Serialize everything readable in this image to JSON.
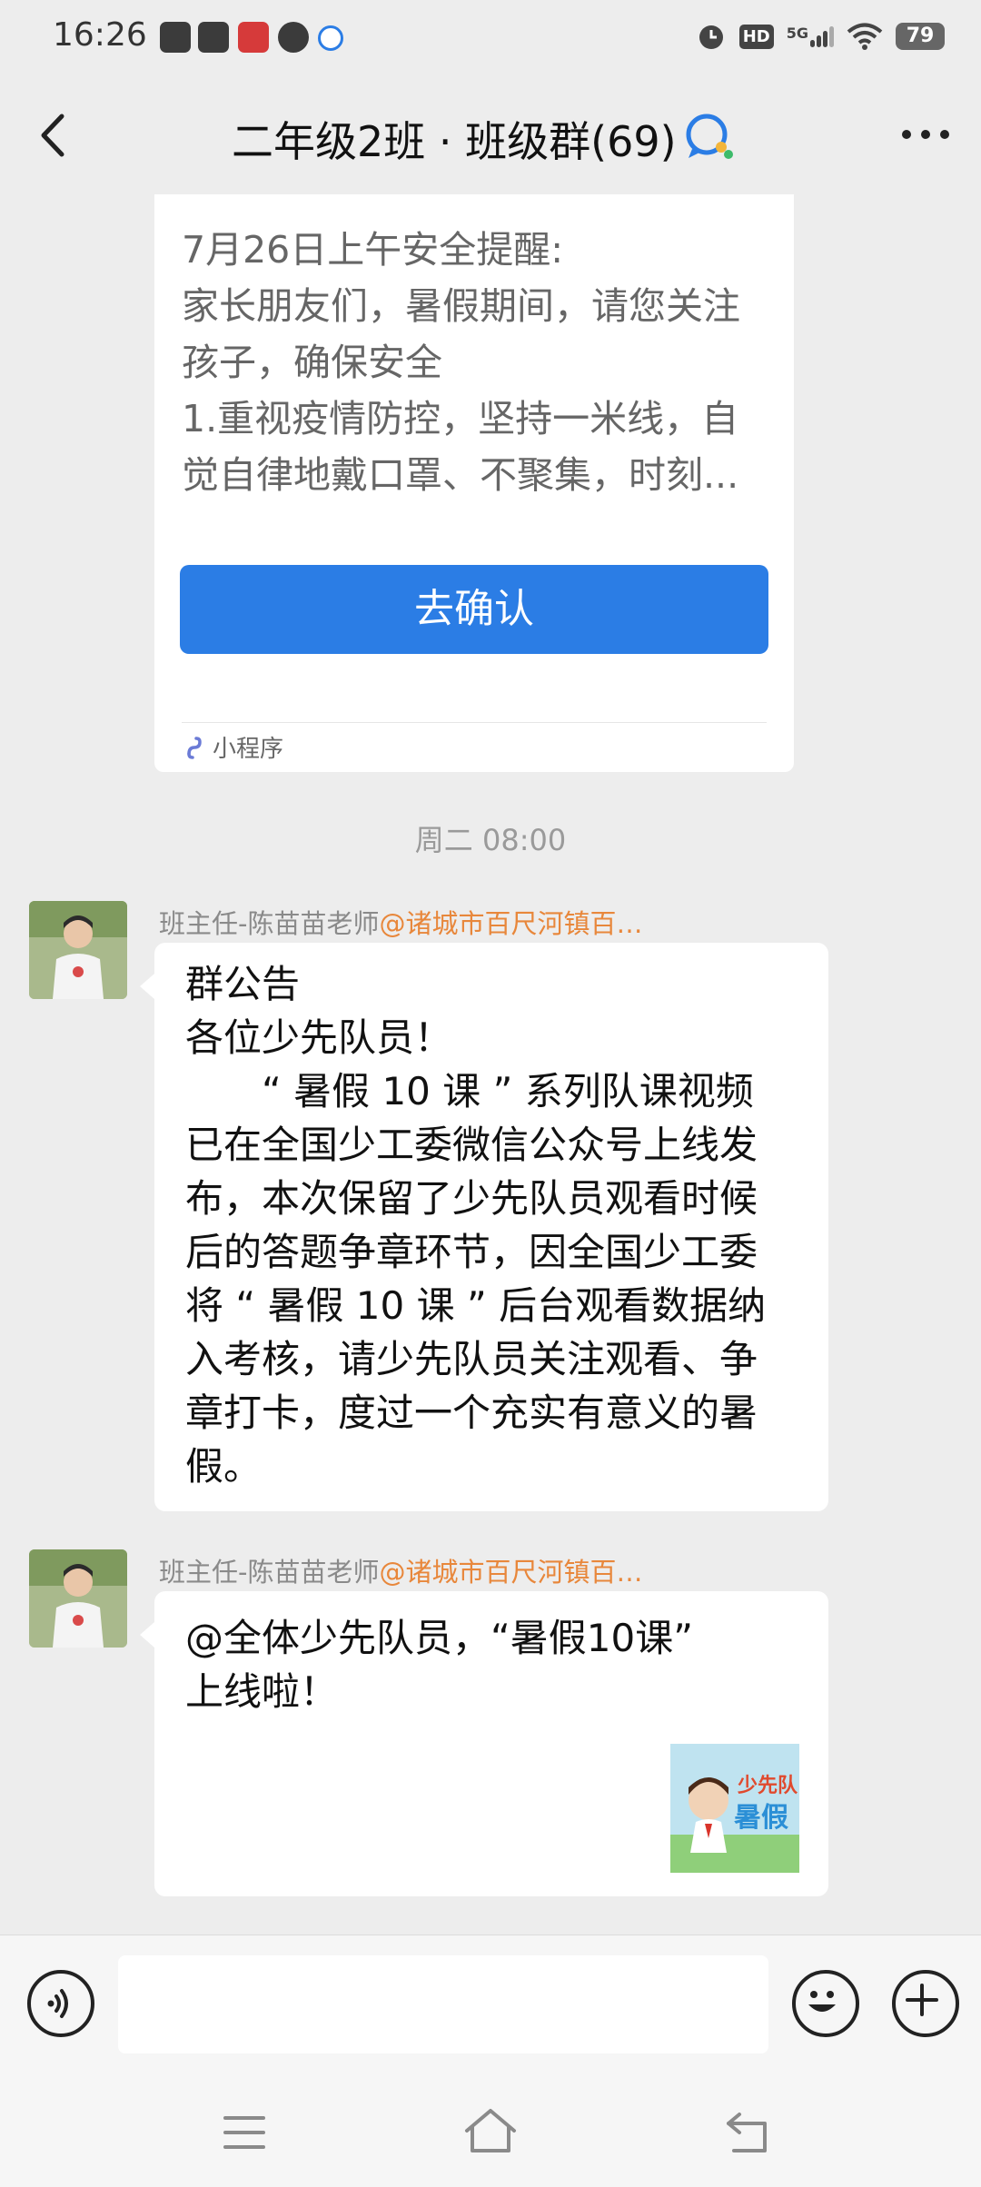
{
  "status_bar": {
    "time": "16:26",
    "icons": [
      "app-icon-1",
      "app-icon-2",
      "app-icon-3",
      "app-icon-4",
      "app-icon-5",
      "alarm-icon",
      "hd-icon",
      "5g-signal-icon",
      "wifi-icon"
    ],
    "network": "5G",
    "hd": "HD",
    "battery": "79"
  },
  "header": {
    "title": "二年级2班 · 班级群(69)",
    "back_icon": "chevron-left-icon",
    "more_icon": "more-dots-icon",
    "group_icon": "chat-bubble-icon"
  },
  "notice_card": {
    "lines": [
      "7月26日上午安全提醒:",
      "家长朋友们，暑假期间，请您关注",
      "孩子，确保安全",
      "1.重视疫情防控，坚持一米线，自",
      "觉自律地戴口罩、不聚集，时刻..."
    ],
    "button_label": "去确认",
    "footer_label": "小程序",
    "footer_icon": "mini-program-icon"
  },
  "timestamp": "周二 08:00",
  "messages": [
    {
      "sender": "班主任-陈苗苗老师",
      "mention": "@诸城市百尺河镇百…",
      "lines": [
        "群公告",
        "各位少先队员！",
        "　　“ 暑假 10 课 ” 系列队课视频",
        "已在全国少工委微信公众号上线发",
        "布，本次保留了少先队员观看时候",
        "后的答题争章环节，因全国少工委",
        "将 “ 暑假 10 课 ” 后台观看数据纳",
        "入考核，请少先队员关注观看、争",
        "章打卡，度过一个充实有意义的暑",
        "假。"
      ]
    },
    {
      "sender": "班主任-陈苗苗老师",
      "mention": "@诸城市百尺河镇百…",
      "lines": [
        "@全体少先队员，“暑假10课”",
        "上线啦！"
      ],
      "thumbnail_text": [
        "少先队",
        "暑假"
      ]
    }
  ],
  "input_bar": {
    "voice_icon": "voice-icon",
    "emoji_icon": "emoji-icon",
    "add_icon": "plus-icon",
    "placeholder": ""
  },
  "system_nav": {
    "icons": [
      "menu-icon",
      "home-icon",
      "back-icon"
    ]
  },
  "colors": {
    "background": "#ededed",
    "button_blue": "#2b7de5",
    "mention_orange": "#e8873b"
  }
}
